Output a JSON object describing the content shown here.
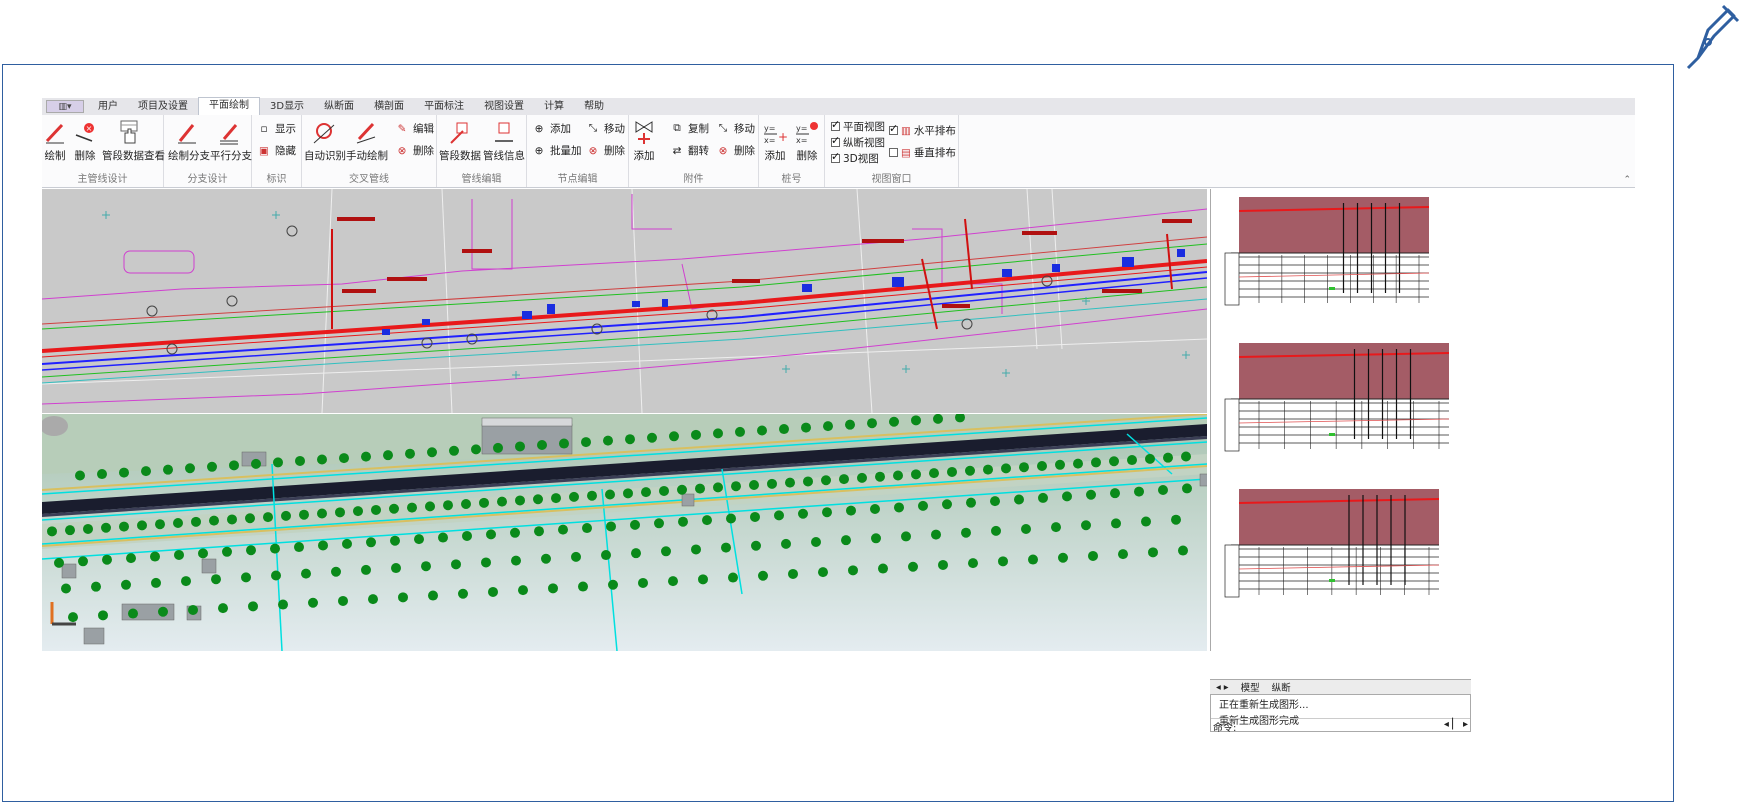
{
  "quick_access": {
    "label": "▥▾"
  },
  "tabs": [
    "用户",
    "项目及设置",
    "平面绘制",
    "3D显示",
    "纵断面",
    "横剖面",
    "平面标注",
    "视图设置",
    "计算",
    "帮助"
  ],
  "active_tab": "平面绘制",
  "ribbon": {
    "groups": {
      "main": "主管线设计",
      "branch": "分支设计",
      "mark": "标识",
      "cross": "交叉管线",
      "pipe_edit": "管线编辑",
      "node_edit": "节点编辑",
      "attach": "附件",
      "pile": "桩号",
      "view_win": "视图窗口"
    },
    "buttons": {
      "draw": "绘制",
      "delete": "删除",
      "seg_data_view": "管段数据查看",
      "draw_branch": "绘制分支",
      "parallel_branch": "平行分支",
      "show": "显示",
      "hide": "隐藏",
      "auto_detect": "自动识别",
      "manual_draw": "手动绘制",
      "cross_edit": "编辑",
      "cross_delete": "删除",
      "seg_data": "管段数据",
      "pipe_info": "管线信息",
      "node_add": "添加",
      "node_batch_add": "批量加",
      "node_move": "移动",
      "node_delete": "删除",
      "attach_add": "添加",
      "attach_copy": "复制",
      "attach_flip": "翻转",
      "attach_move": "移动",
      "attach_delete": "删除",
      "pile_add": "添加",
      "pile_delete": "删除"
    },
    "checks": {
      "plan_view": "平面视图",
      "profile_view": "纵断视图",
      "view_3d": "3D视图",
      "horizontal": "水平排布",
      "vertical": "垂直排布"
    },
    "checked": {
      "plan_view": true,
      "profile_view": true,
      "view_3d": true,
      "horizontal": true,
      "vertical": false
    }
  },
  "layout_tabs": {
    "model": "模型",
    "profile": "纵断"
  },
  "command": {
    "line1": "正在重新生成图形...",
    "line2": "重新生成图形完成",
    "prompt": "命令:"
  },
  "colors": {
    "accent": "#2f5fa0",
    "pipe_red": "#e8191b",
    "profile_fill": "#a45c66"
  }
}
